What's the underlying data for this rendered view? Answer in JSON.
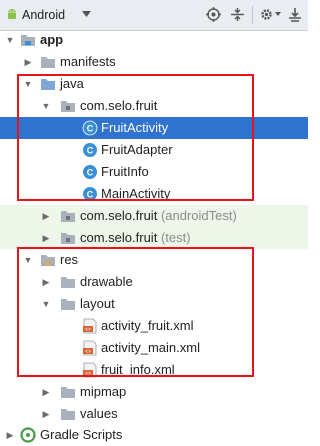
{
  "toolbar": {
    "view_label": "Android",
    "icons": [
      "android-icon",
      "chevron-down-icon",
      "target-icon",
      "collapse-icon",
      "gear-icon",
      "pin-icon"
    ]
  },
  "tree": {
    "app": "app",
    "manifests": "manifests",
    "java": "java",
    "pkg_main": "com.selo.fruit",
    "fruit_activity": "FruitActivity",
    "fruit_adapter": "FruitAdapter",
    "fruit_info": "FruitInfo",
    "main_activity": "MainActivity",
    "pkg_android_test": "com.selo.fruit",
    "pkg_android_test_suffix": "(androidTest)",
    "pkg_test": "com.selo.fruit",
    "pkg_test_suffix": "(test)",
    "res": "res",
    "drawable": "drawable",
    "layout": "layout",
    "activity_fruit_xml": "activity_fruit.xml",
    "activity_main_xml": "activity_main.xml",
    "fruit_info_xml": "fruit_info.xml",
    "mipmap": "mipmap",
    "values": "values",
    "gradle_scripts": "Gradle Scripts"
  },
  "colors": {
    "selection": "#2f72d0",
    "highlight_box": "#e8141c",
    "test_row_bg": "#eef6ea",
    "folder": "#a9b1bd",
    "class_badge": "#3a8fd6"
  }
}
